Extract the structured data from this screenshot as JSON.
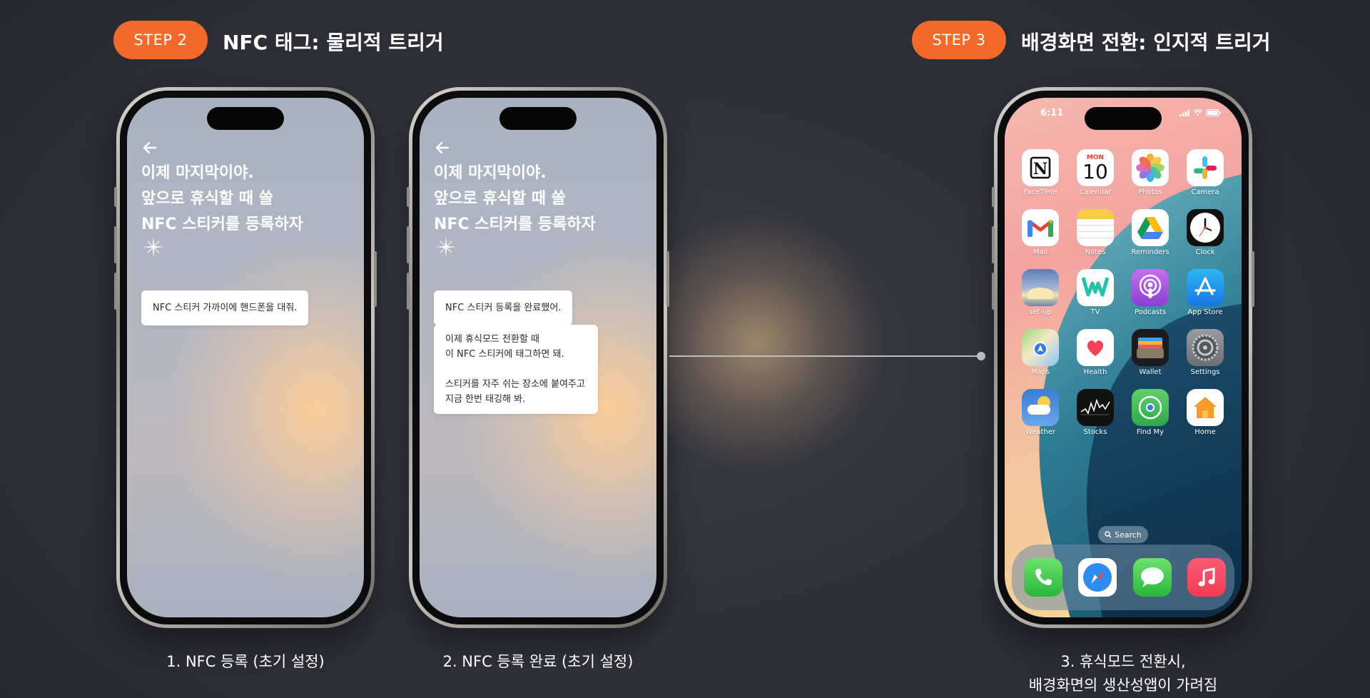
{
  "step2": {
    "pill": "STEP 2",
    "title": "NFC 태그: 물리적 트리거"
  },
  "step3": {
    "pill": "STEP 3",
    "title": "배경화면 전환: 인지적 트리거"
  },
  "phone1": {
    "headline": [
      "이제 마지막이야.",
      "앞으로 휴식할 때 쓸",
      "NFC 스티커를 등록하자"
    ],
    "bubble": "NFC 스티커 가까이에 핸드폰을 대줘.",
    "caption": "1. NFC 등록 (초기 설정)"
  },
  "phone2": {
    "headline": [
      "이제 마지막이야.",
      "앞으로 휴식할 때 쓸",
      "NFC 스티커를 등록하자"
    ],
    "bubble1": "NFC 스티커 등록을 완료했어.",
    "bubble2_lines": [
      "이제 휴식모드 전환할 때",
      "이 NFC 스티커에 태그하면 돼.",
      "",
      "스티커를 자주 쉬는 장소에 붙여주고",
      "지금 한번 태깅해 봐."
    ],
    "caption": "2. NFC 등록 완료 (초기 설정)"
  },
  "phone3": {
    "time": "6:11",
    "apps": [
      {
        "label": "FaceTime",
        "icon": "notion-icon"
      },
      {
        "label": "Calendar",
        "icon": "calendar-icon",
        "day": "MON",
        "date": "10"
      },
      {
        "label": "Photos",
        "icon": "photos-icon"
      },
      {
        "label": "Camera",
        "icon": "slack-icon"
      },
      {
        "label": "Mail",
        "icon": "gmail-icon"
      },
      {
        "label": "Notes",
        "icon": "notes-icon"
      },
      {
        "label": "Reminders",
        "icon": "google-drive-icon"
      },
      {
        "label": "Clock",
        "icon": "clock-icon"
      },
      {
        "label": "set-up",
        "icon": "setup-icon"
      },
      {
        "label": "TV",
        "icon": "naver-w-icon"
      },
      {
        "label": "Podcasts",
        "icon": "podcasts-icon"
      },
      {
        "label": "App Store",
        "icon": "app-store-icon"
      },
      {
        "label": "Maps",
        "icon": "maps-icon"
      },
      {
        "label": "Health",
        "icon": "health-icon"
      },
      {
        "label": "Wallet",
        "icon": "wallet-icon"
      },
      {
        "label": "Settings",
        "icon": "settings-icon"
      },
      {
        "label": "Weather",
        "icon": "weather-icon"
      },
      {
        "label": "Stocks",
        "icon": "stocks-icon"
      },
      {
        "label": "Find My",
        "icon": "find-my-icon"
      },
      {
        "label": "Home",
        "icon": "home-icon"
      }
    ],
    "search": "Search",
    "dock": [
      "phone-icon",
      "safari-icon",
      "messages-icon",
      "music-icon"
    ],
    "caption_lines": [
      "3. 휴식모드 전환시,",
      "배경화면의 생산성앱이 가려짐"
    ]
  }
}
